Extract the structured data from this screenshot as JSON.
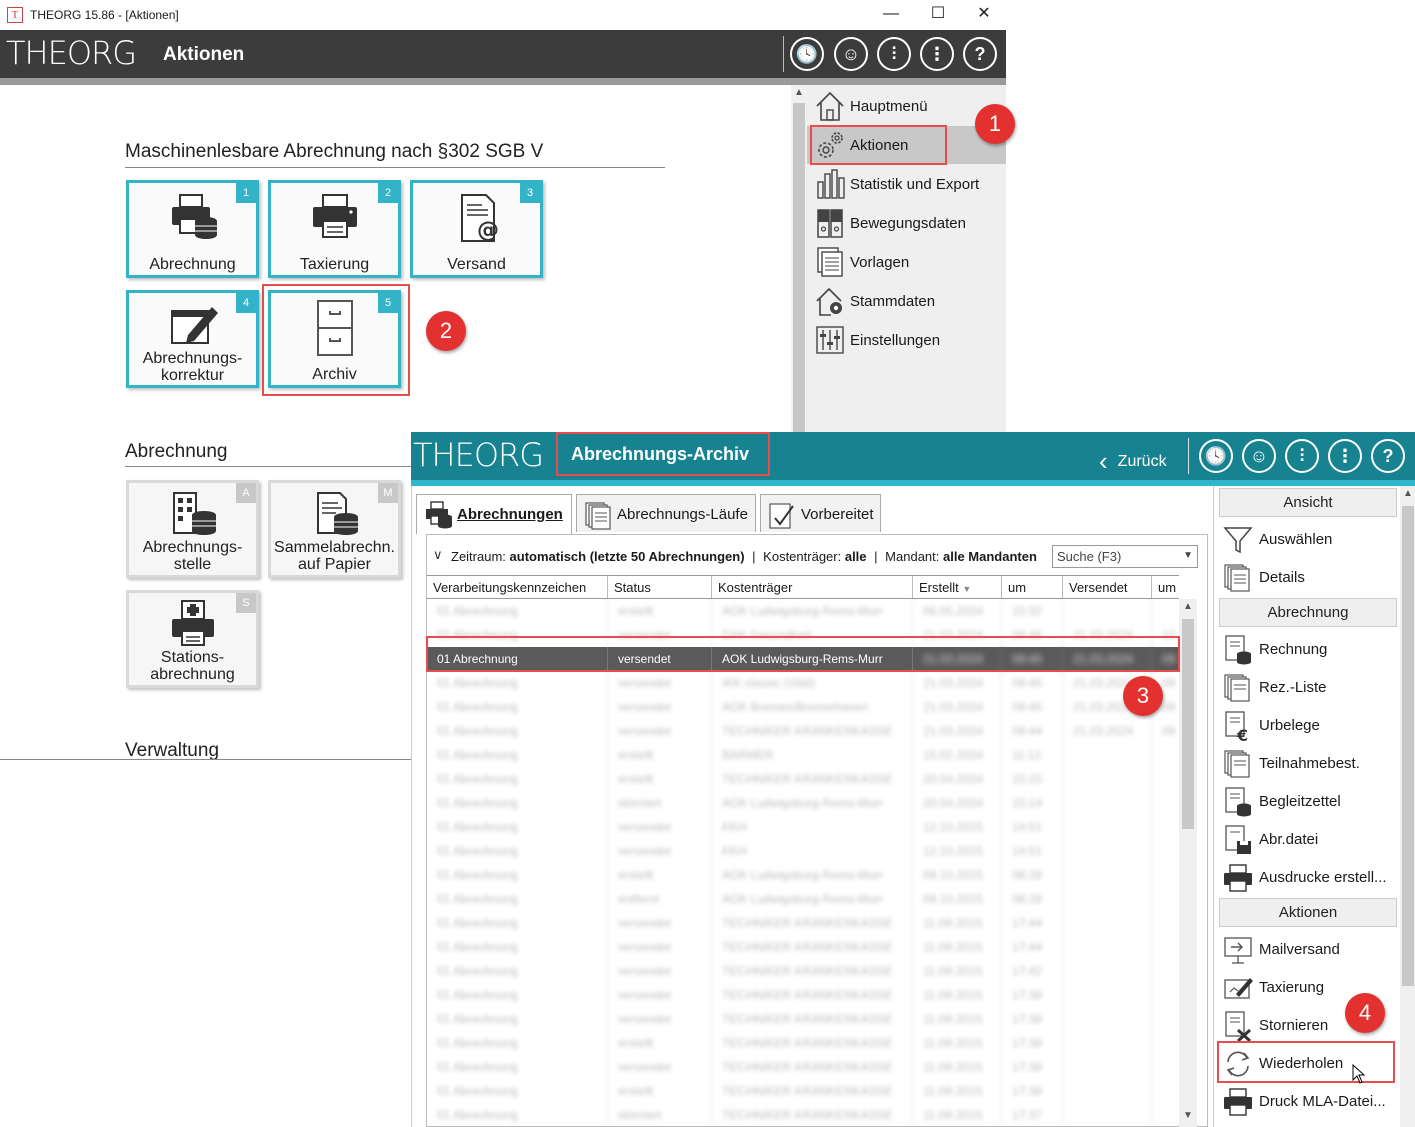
{
  "window": {
    "title": "THEORG 15.86 - [Aktionen]",
    "app_icon_letter": "T",
    "minimize": "—",
    "maximize": "☐",
    "close": "✕"
  },
  "back_header": {
    "logo": "THEORG",
    "title": "Aktionen",
    "icons": [
      "history-icon",
      "user-icon",
      "settings-sliders-icon",
      "more-icon",
      "help-icon"
    ],
    "icon_glyphs": [
      "🕓",
      "☺",
      "⫶",
      "⋮",
      "?"
    ]
  },
  "mla_section": {
    "title": "Maschinenlesbare Abrechnung nach §302 SGB V",
    "tiles": [
      {
        "label": "Abrechnung",
        "badge": "1"
      },
      {
        "label": "Taxierung",
        "badge": "2"
      },
      {
        "label": "Versand",
        "badge": "3"
      },
      {
        "label_line1": "Abrechnungs-",
        "label_line2": "korrektur",
        "badge": "4"
      },
      {
        "label": "Archiv",
        "badge": "5"
      }
    ]
  },
  "abrechnung_section": {
    "title": "Abrechnung",
    "tiles": [
      {
        "label_line1": "Abrechnungs-",
        "label_line2": "stelle",
        "badge": "A"
      },
      {
        "label_line1": "Sammelabrechn.",
        "label_line2": "auf Papier",
        "badge": "M"
      },
      {
        "label_line1": "Stations-",
        "label_line2": "abrechnung",
        "badge": "S"
      }
    ]
  },
  "verwaltung_section": {
    "title": "Verwaltung"
  },
  "back_menu": {
    "items": [
      {
        "label": "Hauptmenü",
        "active": false
      },
      {
        "label": "Aktionen",
        "active": true
      },
      {
        "label": "Statistik und Export",
        "active": false
      },
      {
        "label": "Bewegungsdaten",
        "active": false
      },
      {
        "label": "Vorlagen",
        "active": false
      },
      {
        "label": "Stammdaten",
        "active": false
      },
      {
        "label": "Einstellungen",
        "active": false
      }
    ]
  },
  "callouts": [
    "1",
    "2",
    "3",
    "4"
  ],
  "front_header": {
    "logo": "THEORG",
    "title": "Abrechnungs-Archiv",
    "back_label": "Zurück",
    "back_glyph": "‹"
  },
  "tabs": [
    {
      "label": "Abrechnungen",
      "active": true
    },
    {
      "label": "Abrechnungs-Läufe",
      "active": false
    },
    {
      "label": "Vorbereitet",
      "active": false
    }
  ],
  "filter": {
    "chevron": "∨",
    "zeitraum_label": "Zeitraum:",
    "zeitraum_value": "automatisch (letzte 50 Abrechnungen)",
    "kostentraeger_label": "Kostenträger:",
    "kostentraeger_value": "alle",
    "mandant_label": "Mandant:",
    "mandant_value": "alle Mandanten",
    "separator": "|",
    "search_placeholder": "Suche (F3)",
    "dropdown_glyph": "▼"
  },
  "grid": {
    "columns": [
      "Verarbeitungskennzeichen",
      "Status",
      "Kostenträger",
      "Erstellt",
      "um",
      "Versendet",
      "um"
    ],
    "sort_glyph": "▼",
    "rows": [
      [
        "01 Abrechnung",
        "erstellt",
        "AOK Ludwigsburg-Rems-Murr",
        "06.05.2024",
        "15:32",
        "",
        ""
      ],
      [
        "01 Abrechnung",
        "versendet",
        "DAK Gesundheit",
        "21.03.2024",
        "09:46",
        "21.03.2024",
        "10"
      ],
      [
        "01 Abrechnung",
        "versendet",
        "AOK Ludwigsburg-Rems-Murr",
        "21.03.2024",
        "09:45",
        "21.03.2024",
        "09"
      ],
      [
        "01 Abrechnung",
        "versendet",
        "IKK classic (Vital)",
        "21.03.2024",
        "09:45",
        "21.03.2024",
        "09"
      ],
      [
        "01 Abrechnung",
        "versendet",
        "AOK Bremen/Bremerhaven",
        "21.03.2024",
        "09:45",
        "21.03.2024",
        "09"
      ],
      [
        "01 Abrechnung",
        "versendet",
        "TECHNIKER KRANKENKASSE",
        "21.03.2024",
        "09:44",
        "21.03.2024",
        "09"
      ],
      [
        "01 Abrechnung",
        "erstellt",
        "BARMER",
        "15.02.2024",
        "11:12",
        "",
        ""
      ],
      [
        "01 Abrechnung",
        "erstellt",
        "TECHNIKER KRANKENKASSE",
        "20.04.2024",
        "15:15",
        "",
        ""
      ],
      [
        "01 Abrechnung",
        "storniert",
        "AOK Ludwigsburg-Rems-Murr",
        "20.04.2024",
        "15:14",
        "",
        ""
      ],
      [
        "01 Abrechnung",
        "versendet",
        "KKH",
        "12.10.2015",
        "14:51",
        "",
        ""
      ],
      [
        "01 Abrechnung",
        "versendet",
        "KKH",
        "12.10.2015",
        "14:51",
        "",
        ""
      ],
      [
        "01 Abrechnung",
        "erstellt",
        "AOK Ludwigsburg-Rems-Murr",
        "09.10.2015",
        "08:28",
        "",
        ""
      ],
      [
        "01 Abrechnung",
        "entfernt",
        "AOK Ludwigsburg-Rems-Murr",
        "09.10.2015",
        "08:28",
        "",
        ""
      ],
      [
        "01 Abrechnung",
        "versendet",
        "TECHNIKER KRANKENKASSE",
        "11.09.2015",
        "17:44",
        "",
        ""
      ],
      [
        "01 Abrechnung",
        "versendet",
        "TECHNIKER KRANKENKASSE",
        "11.09.2015",
        "17:44",
        "",
        ""
      ],
      [
        "01 Abrechnung",
        "versendet",
        "TECHNIKER KRANKENKASSE",
        "11.09.2015",
        "17:42",
        "",
        ""
      ],
      [
        "01 Abrechnung",
        "versendet",
        "TECHNIKER KRANKENKASSE",
        "11.09.2015",
        "17:38",
        "",
        ""
      ],
      [
        "01 Abrechnung",
        "versendet",
        "TECHNIKER KRANKENKASSE",
        "11.09.2015",
        "17:38",
        "",
        ""
      ],
      [
        "01 Abrechnung",
        "erstellt",
        "TECHNIKER KRANKENKASSE",
        "11.09.2015",
        "17:38",
        "",
        ""
      ],
      [
        "01 Abrechnung",
        "versendet",
        "TECHNIKER KRANKENKASSE",
        "11.09.2015",
        "17:38",
        "",
        ""
      ],
      [
        "01 Abrechnung",
        "erstellt",
        "TECHNIKER KRANKENKASSE",
        "11.09.2015",
        "17:38",
        "",
        ""
      ],
      [
        "01 Abrechnung",
        "storniert",
        "TECHNIKER KRANKENKASSE",
        "11.09.2015",
        "17:37",
        "",
        ""
      ]
    ],
    "selected_row": [
      "01 Abrechnung",
      "versendet",
      "AOK Ludwigsburg-Rems-Murr",
      "21.03.2024",
      "09:45",
      "21.03.2024",
      "09"
    ],
    "scroll_up": "▲",
    "scroll_down": "▼"
  },
  "side_panel": {
    "ansicht_head": "Ansicht",
    "ansicht_items": [
      "Auswählen",
      "Details"
    ],
    "abrechnung_head": "Abrechnung",
    "abrechnung_items": [
      "Rechnung",
      "Rez.-Liste",
      "Urbelege",
      "Teilnahmebest.",
      "Begleitzettel",
      "Abr.datei",
      "Ausdrucke erstell..."
    ],
    "aktionen_head": "Aktionen",
    "aktionen_items": [
      "Mailversand",
      "Taxierung",
      "Stornieren",
      "Wiederholen",
      "Druck MLA-Datei..."
    ],
    "scroll_up": "▲"
  },
  "colors": {
    "back_header": "#3c3c3c",
    "front_header": "#178391",
    "accent_teal": "#32b3c7",
    "callout_red": "#e2312f",
    "selected_row": "#5a5a5a"
  }
}
